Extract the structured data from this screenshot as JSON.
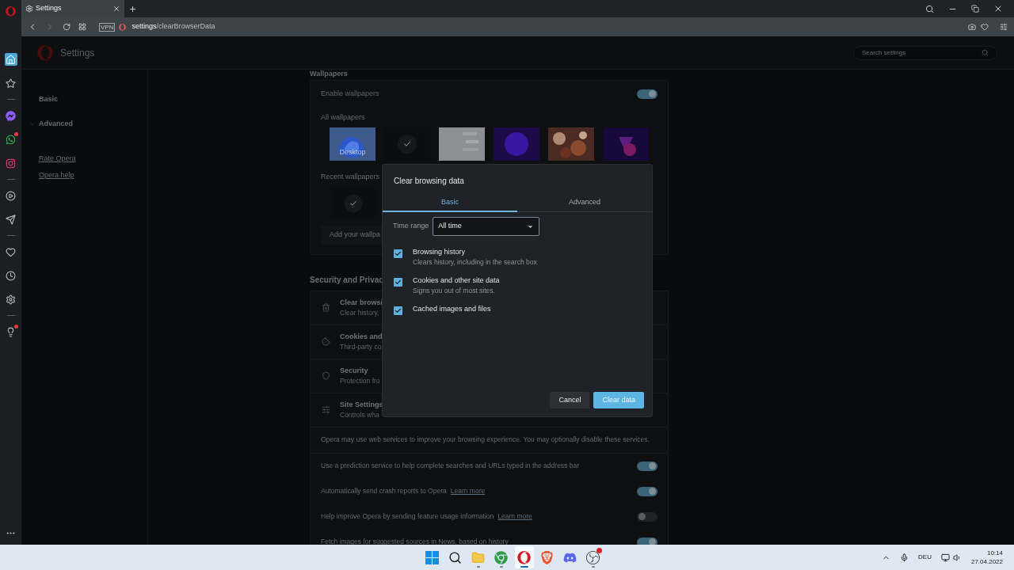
{
  "browser": {
    "tab": {
      "title": "Settings"
    },
    "address": {
      "vpn": "VPN",
      "host": "settings",
      "path": "/clearBrowserData"
    }
  },
  "sidebar": [
    {
      "kind": "button",
      "selected": false,
      "badge": false
    },
    {
      "kind": "button",
      "selected": true,
      "badge": false
    },
    {
      "kind": "button",
      "selected": false,
      "badge": false
    },
    {
      "kind": "divider"
    },
    {
      "kind": "button",
      "selected": false,
      "badge": false
    },
    {
      "kind": "button",
      "selected": false,
      "badge": true
    },
    {
      "kind": "button",
      "selected": false,
      "badge": false
    },
    {
      "kind": "divider"
    },
    {
      "kind": "button",
      "selected": false,
      "badge": false
    },
    {
      "kind": "button",
      "selected": false,
      "badge": false
    },
    {
      "kind": "divider"
    },
    {
      "kind": "button",
      "selected": false,
      "badge": false
    },
    {
      "kind": "button",
      "selected": false,
      "badge": false
    },
    {
      "kind": "button",
      "selected": false,
      "badge": false
    },
    {
      "kind": "divider"
    },
    {
      "kind": "button",
      "selected": false,
      "badge": true
    }
  ],
  "header": {
    "title": "Settings",
    "search_placeholder": "Search settings"
  },
  "nav": [
    {
      "label": "Basic",
      "kind": "item"
    },
    {
      "label": "Advanced",
      "kind": "expander",
      "expanded": true
    },
    {
      "label": "Rate Opera",
      "kind": "link"
    },
    {
      "label": "Opera help",
      "kind": "link"
    }
  ],
  "wallpapers": {
    "heading": "Wallpapers",
    "enable": {
      "label": "Enable wallpapers",
      "on": true
    },
    "all_label": "All wallpapers",
    "thumbnails": [
      {
        "caption": "Desktop",
        "selected": false
      },
      {
        "selected": true
      },
      {
        "selected": false
      },
      {
        "selected": false
      },
      {
        "selected": false
      },
      {
        "selected": false
      }
    ],
    "recent_label": "Recent wallpapers",
    "recent": [
      {
        "selected": true
      }
    ],
    "add_button": "Add your wallpa"
  },
  "security": {
    "heading": "Security and Privac",
    "rows": [
      {
        "title": "Clear browsi",
        "subtitle": "Clear history,"
      },
      {
        "title": "Cookies and",
        "subtitle": "Third-party co"
      },
      {
        "title": "Security",
        "subtitle": "Protection fro"
      },
      {
        "title": "Site Settings",
        "subtitle": "Controls wha"
      }
    ],
    "notice": "Opera may use web services to improve your browsing experience. You may optionally disable these services.",
    "toggles": [
      {
        "label": "Use a prediction service to help complete searches and URLs typed in the address bar",
        "on": true
      },
      {
        "label": "Automatically send crash reports to Opera",
        "link": "Learn more",
        "on": true
      },
      {
        "label": "Help improve Opera by sending feature usage information",
        "link": "Learn more",
        "on": false
      },
      {
        "label": "Fetch images for suggested sources in News, based on history",
        "on": true
      }
    ]
  },
  "dialog": {
    "title": "Clear browsing data",
    "tabs": [
      {
        "label": "Basic",
        "selected": true
      },
      {
        "label": "Advanced",
        "selected": false
      }
    ],
    "time_range": {
      "label": "Time range",
      "value": "All time"
    },
    "options": [
      {
        "title": "Browsing history",
        "subtitle": "Clears history, including in the search box",
        "checked": true
      },
      {
        "title": "Cookies and other site data",
        "subtitle": "Signs you out of most sites.",
        "checked": true
      },
      {
        "title": "Cached images and files",
        "checked": true
      }
    ],
    "buttons": [
      {
        "label": "Cancel",
        "kind": "secondary"
      },
      {
        "label": "Clear data",
        "kind": "primary"
      }
    ]
  },
  "taskbar": {
    "apps": [
      {
        "selected": false,
        "running": false,
        "badge": false
      },
      {
        "selected": false,
        "running": false,
        "badge": false
      },
      {
        "selected": false,
        "running": true,
        "badge": false
      },
      {
        "selected": false,
        "running": true,
        "badge": false
      },
      {
        "selected": true,
        "running": true,
        "badge": false
      },
      {
        "selected": false,
        "running": false,
        "badge": false
      },
      {
        "selected": false,
        "running": false,
        "badge": false
      },
      {
        "selected": false,
        "running": true,
        "badge": true
      }
    ],
    "language": "DEU",
    "time": "10:14",
    "date": "27.04.2022"
  }
}
